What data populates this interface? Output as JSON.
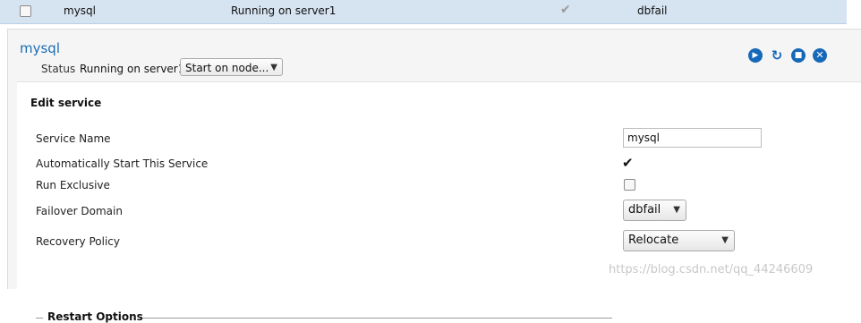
{
  "list_row": {
    "name": "mysql",
    "status": "Running on server1",
    "autostart_checked": true,
    "domain": "dbfail"
  },
  "panel": {
    "title": "mysql",
    "status_label": "Status",
    "status_value": "Running on server1",
    "start_select": "Start on node...",
    "actions": [
      "start-icon",
      "restart-icon",
      "stop-icon",
      "delete-icon"
    ]
  },
  "edit": {
    "title": "Edit service",
    "service_name_label": "Service Name",
    "service_name_value": "mysql",
    "autostart_label": "Automatically Start This Service",
    "autostart_checked": true,
    "run_exclusive_label": "Run Exclusive",
    "run_exclusive_checked": false,
    "failover_label": "Failover Domain",
    "failover_value": "dbfail",
    "recovery_label": "Recovery Policy",
    "recovery_value": "Relocate",
    "restart_options": "Restart Options"
  },
  "watermark": "https://blog.csdn.net/qq_44246609",
  "colors": {
    "accent": "#1668b8",
    "row_selected": "#d6e3f1"
  }
}
